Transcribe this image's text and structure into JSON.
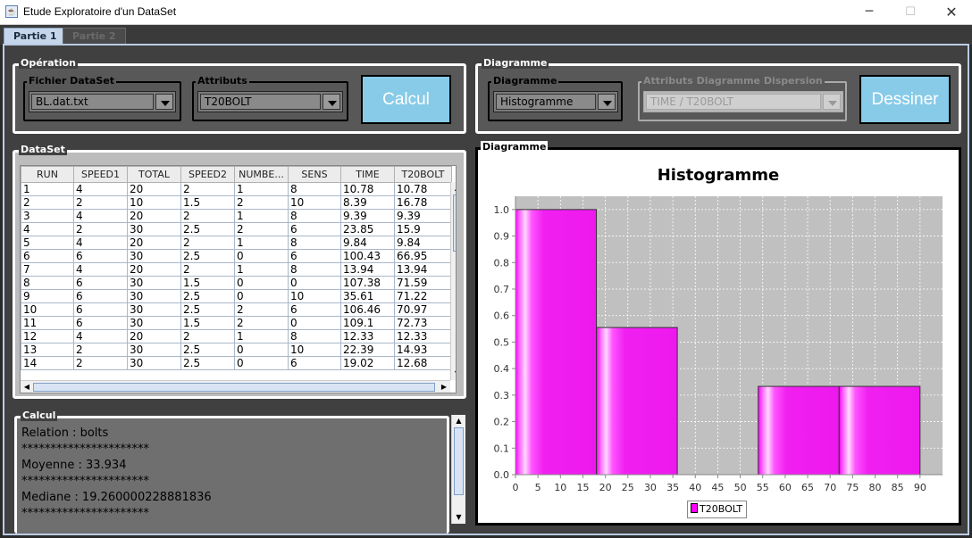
{
  "window": {
    "title": "Etude Exploratoire d'un DataSet",
    "minimize": "─",
    "maximize": "☐",
    "close": "✕"
  },
  "tabs": [
    {
      "label": "Partie 1",
      "active": true
    },
    {
      "label": "Partie 2",
      "active": false
    }
  ],
  "operation": {
    "title": "Opération",
    "file_group": "Fichier DataSet",
    "file_value": "BL.dat.txt",
    "attr_group": "Attributs",
    "attr_value": "T20BOLT",
    "calc_button": "Calcul"
  },
  "diagram_controls": {
    "title": "Diagramme",
    "type_group": "Diagramme",
    "type_value": "Histogramme",
    "scatter_group": "Attributs Diagramme Dispersion",
    "scatter_value": "TIME / T20BOLT",
    "draw_button": "Dessiner"
  },
  "dataset": {
    "title": "DataSet",
    "columns": [
      "RUN",
      "SPEED1",
      "TOTAL",
      "SPEED2",
      "NUMBE...",
      "SENS",
      "TIME",
      "T20BOLT"
    ],
    "rows": [
      [
        "1",
        "4",
        "20",
        "2",
        "1",
        "8",
        "10.78",
        "10.78"
      ],
      [
        "2",
        "2",
        "10",
        "1.5",
        "2",
        "10",
        "8.39",
        "16.78"
      ],
      [
        "3",
        "4",
        "20",
        "2",
        "1",
        "8",
        "9.39",
        "9.39"
      ],
      [
        "4",
        "2",
        "30",
        "2.5",
        "2",
        "6",
        "23.85",
        "15.9"
      ],
      [
        "5",
        "4",
        "20",
        "2",
        "1",
        "8",
        "9.84",
        "9.84"
      ],
      [
        "6",
        "6",
        "30",
        "2.5",
        "0",
        "6",
        "100.43",
        "66.95"
      ],
      [
        "7",
        "4",
        "20",
        "2",
        "1",
        "8",
        "13.94",
        "13.94"
      ],
      [
        "8",
        "6",
        "30",
        "1.5",
        "0",
        "0",
        "107.38",
        "71.59"
      ],
      [
        "9",
        "6",
        "30",
        "2.5",
        "0",
        "10",
        "35.61",
        "71.22"
      ],
      [
        "10",
        "6",
        "30",
        "2.5",
        "2",
        "6",
        "106.46",
        "70.97"
      ],
      [
        "11",
        "6",
        "30",
        "1.5",
        "2",
        "0",
        "109.1",
        "72.73"
      ],
      [
        "12",
        "4",
        "20",
        "2",
        "1",
        "8",
        "12.33",
        "12.33"
      ],
      [
        "13",
        "2",
        "30",
        "2.5",
        "0",
        "10",
        "22.39",
        "14.93"
      ],
      [
        "14",
        "2",
        "30",
        "2.5",
        "0",
        "6",
        "19.02",
        "12.68"
      ]
    ]
  },
  "calcul": {
    "title": "Calcul",
    "lines": [
      "Relation : bolts",
      "**********************",
      "Moyenne : 33.934",
      "**********************",
      "Mediane : 19.260000228881836",
      "**********************"
    ]
  },
  "chart_panel": {
    "title": "Diagramme"
  },
  "colors": {
    "bar": "#ff00ff",
    "plot_bg": "#c0c0c0",
    "button": "#87cbe8"
  },
  "chart_data": {
    "type": "bar",
    "title": "Histogramme",
    "bins": [
      {
        "from": 0,
        "to": 18,
        "value": 1.0
      },
      {
        "from": 18,
        "to": 36,
        "value": 0.555
      },
      {
        "from": 36,
        "to": 54,
        "value": 0
      },
      {
        "from": 54,
        "to": 72,
        "value": 0.333
      },
      {
        "from": 72,
        "to": 90,
        "value": 0.333
      }
    ],
    "x_ticks": [
      0,
      5,
      10,
      15,
      20,
      25,
      30,
      35,
      40,
      45,
      50,
      55,
      60,
      65,
      70,
      75,
      80,
      85,
      90
    ],
    "y_ticks": [
      "0.0",
      "0.1",
      "0.2",
      "0.3",
      "0.4",
      "0.5",
      "0.6",
      "0.7",
      "0.8",
      "0.9",
      "1.0"
    ],
    "xlim": [
      0,
      95
    ],
    "ylim": [
      0,
      1.05
    ],
    "grid": true,
    "legend": "bottom-center",
    "series": [
      {
        "name": "T20BOLT"
      }
    ]
  }
}
